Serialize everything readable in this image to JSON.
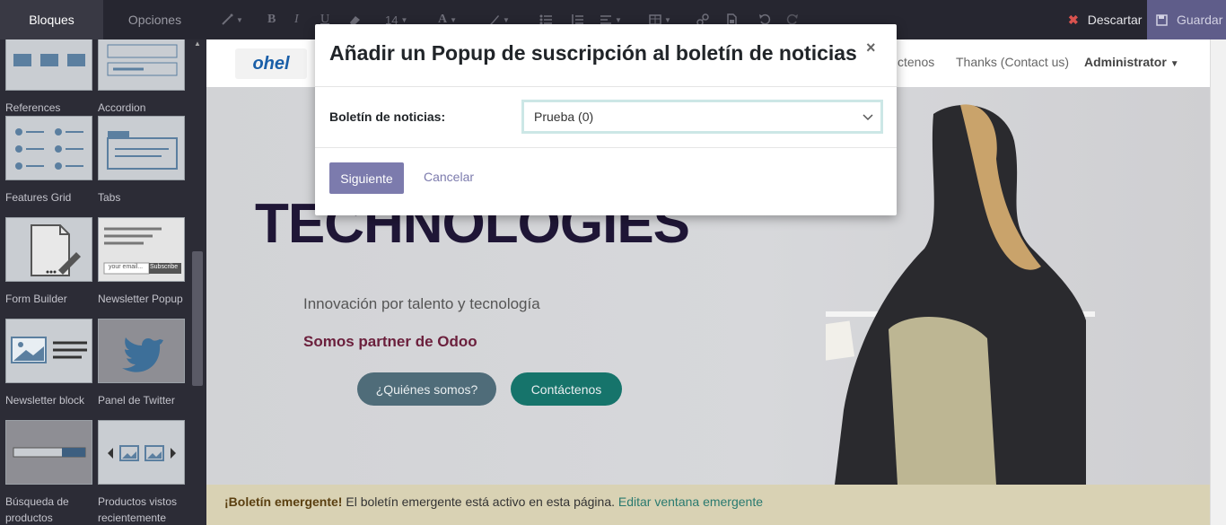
{
  "sidebar": {
    "tabs": [
      {
        "label": "Bloques"
      },
      {
        "label": "Opciones"
      }
    ],
    "snippets": [
      {
        "label": "References"
      },
      {
        "label": "Accordion"
      },
      {
        "label": "Features Grid"
      },
      {
        "label": "Tabs"
      },
      {
        "label": "Form Builder"
      },
      {
        "label": "Newsletter Popup",
        "thumb_input": "your email...",
        "thumb_button": "Subscribe"
      },
      {
        "label": "Newsletter block"
      },
      {
        "label": "Panel de Twitter"
      },
      {
        "label": "Búsqueda de productos"
      },
      {
        "label": "Productos vistos recientemente"
      }
    ]
  },
  "toolbar": {
    "font_size": "14",
    "discard_label": "Descartar",
    "save_label": "Guardar"
  },
  "site": {
    "logo_text": "ohel",
    "nav": {
      "contact": "ctenos",
      "thanks": "Thanks (Contact us)",
      "admin": "Administrator"
    },
    "hero": {
      "title": "TECHNOLOGIES",
      "subtitle": "Innovación por talento y tecnología",
      "partner": "Somos partner de Odoo",
      "about_button": "¿Quiénes somos?",
      "contact_button": "Contáctenos"
    },
    "notice": {
      "strong": "¡Boletín emergente!",
      "text": " El boletín emergente está activo en esta página. ",
      "link": "Editar ventana emergente"
    }
  },
  "modal": {
    "title": "Añadir un Popup de suscripción al boletín de noticias",
    "close": "×",
    "field_label": "Boletín de noticias:",
    "field_value": "Prueba (0)",
    "next": "Siguiente",
    "cancel": "Cancelar"
  },
  "colors": {
    "primary": "#7c7bad",
    "save_bg": "#5f5d8a",
    "discard_icon": "#d9534f"
  }
}
